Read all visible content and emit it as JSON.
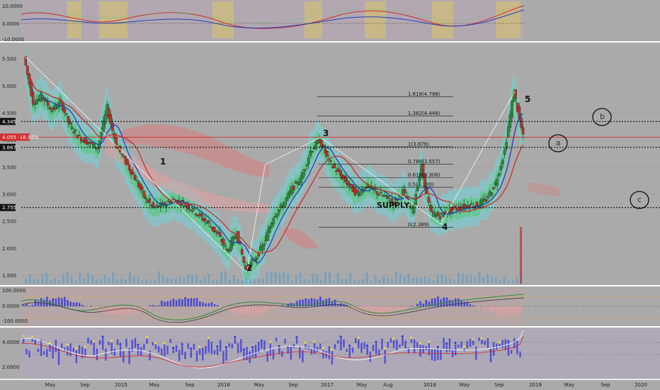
{
  "colors": {
    "background": "#aaaaaa",
    "bull": "#2e8b3a",
    "bear": "#c0302a",
    "band_teal": "#6fd3d8",
    "band_green": "#3fcf5a",
    "cloud_red": "#d97b7b",
    "ema_blue": "#1f3fbf",
    "ema_red": "#d22b2b",
    "tag_black": "#111111",
    "tag_red": "#d22b2b"
  },
  "chart_data": [
    {
      "type": "line",
      "panel": "top-indicator",
      "y_ticks": [
        "10.0000",
        "0.0000",
        "-10.0000"
      ],
      "ylim": [
        -10,
        10
      ]
    },
    {
      "type": "candlestick",
      "panel": "main",
      "ylim": [
        1.35,
        5.75
      ],
      "y_ticks": [
        1.5,
        2.0,
        2.5,
        3.0,
        3.5,
        4.0,
        4.5,
        5.0,
        5.5
      ],
      "y_tick_labels": [
        "1.500",
        "2.000",
        "2.500",
        "3.000",
        "3.500",
        "4.000",
        "4.500",
        "5.000",
        "5.500"
      ],
      "x_tick_labels": [
        "May",
        "Sep",
        "2015",
        "May",
        "Sep",
        "2016",
        "May",
        "Sep",
        "2017",
        "May",
        "Aug",
        "Sep",
        "2018",
        "May",
        "Sep",
        "2019",
        "May",
        "Sep",
        "2020"
      ],
      "price_series": [
        5.55,
        4.7,
        4.8,
        4.55,
        4.7,
        4.25,
        4.05,
        3.95,
        3.85,
        4.6,
        3.9,
        3.6,
        3.3,
        2.95,
        2.75,
        2.8,
        2.9,
        2.85,
        2.75,
        2.6,
        2.45,
        2.25,
        1.95,
        2.3,
        1.6,
        1.8,
        2.1,
        2.6,
        2.8,
        3.1,
        3.3,
        3.8,
        4.0,
        3.6,
        3.4,
        3.2,
        3.0,
        3.15,
        3.05,
        2.95,
        2.85,
        3.05,
        2.7,
        3.5,
        2.65,
        2.6,
        2.7,
        2.75,
        2.8,
        2.8,
        2.9,
        3.2,
        3.8,
        4.9,
        4.06
      ],
      "horizontal_lines": [
        {
          "label": "4.345",
          "value": 4.345,
          "style": "dotted",
          "color": "#111111"
        },
        {
          "label": "4.055 -18.94%",
          "value": 4.055,
          "style": "solid",
          "color": "#d22b2b"
        },
        {
          "label": "3.867",
          "value": 3.867,
          "style": "dotted",
          "color": "#111111"
        },
        {
          "label": "2.755",
          "value": 2.755,
          "style": "dotted",
          "color": "#111111"
        }
      ],
      "fib_levels": [
        {
          "label": "1.618(4.798)",
          "value": 4.798
        },
        {
          "label": "1.382(4.446)",
          "value": 4.446
        },
        {
          "label": "1(3.876)",
          "value": 3.876
        },
        {
          "label": "0.786(3.557)",
          "value": 3.557
        },
        {
          "label": "0.618(3.306)",
          "value": 3.306
        },
        {
          "label": "0.5(3.130)",
          "value": 3.13
        },
        {
          "label": "0(2.389)",
          "value": 2.389
        }
      ],
      "wave_labels": [
        {
          "label": "1",
          "value": 3.55,
          "index": 26
        },
        {
          "label": "2",
          "value": 1.55,
          "index": 24
        },
        {
          "label": "3",
          "value": 4.05,
          "index": 32
        },
        {
          "label": "4",
          "value": 2.45,
          "index": 45
        },
        {
          "label": "5",
          "value": 4.9,
          "index": 53
        }
      ],
      "annotations": [
        {
          "label": "a",
          "value": 3.9
        },
        {
          "label": "b",
          "value": 4.42
        },
        {
          "label": "c",
          "value": 2.8
        },
        {
          "label": "SUPPLY",
          "value": 2.75
        }
      ]
    },
    {
      "type": "bar",
      "panel": "oscillator-1",
      "y_ticks": [
        "100.0000",
        "0.0000",
        "-100.0000"
      ],
      "ylim": [
        -100,
        100
      ]
    },
    {
      "type": "bar",
      "panel": "oscillator-2",
      "y_ticks": [
        "4.0000",
        "2.0000"
      ],
      "ylim": [
        1,
        5
      ]
    }
  ]
}
